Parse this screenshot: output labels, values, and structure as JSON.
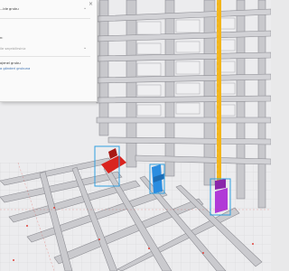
{
  "panel": {
    "close_symbol": "×",
    "line1": "...ide grubu",
    "line2": "n:",
    "line3": "ile seçebilirsiniz",
    "line4": "ojenel grubu",
    "line5": "a gönderi grubuna"
  },
  "icons": {
    "close": "close-icon",
    "chevron": "chevron-down-icon",
    "selection_box": "selection-box-icon"
  },
  "colors": {
    "background": "#e9e9ea",
    "structure": "#c9c9cc",
    "structure_dark": "#9c9ca2",
    "highlight_yellow": "#f2b51b",
    "red_element": "#d9241f",
    "blue_element": "#2b8de0",
    "purple_element": "#b13ad7",
    "selection_box": "#2f9fe0",
    "axis_red": "#e0433b"
  }
}
